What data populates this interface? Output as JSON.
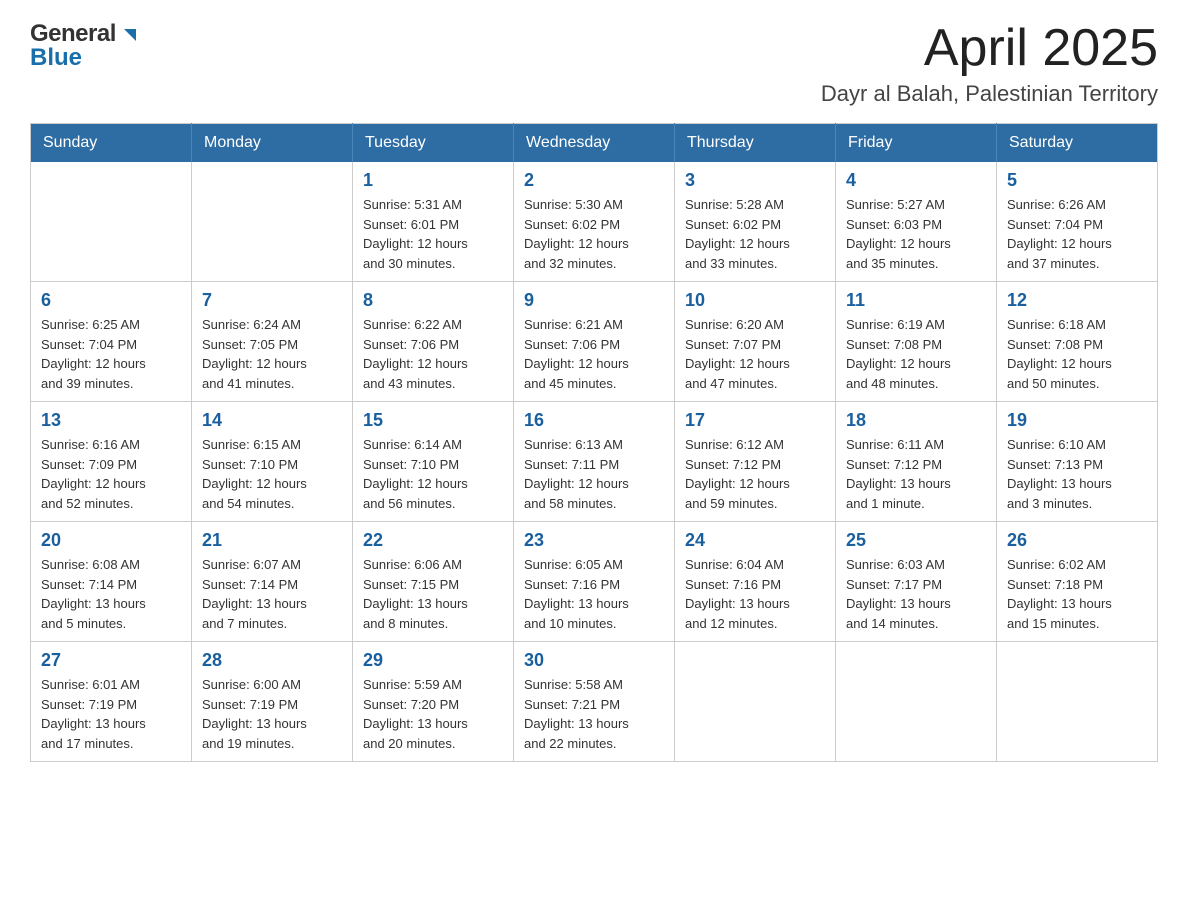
{
  "header": {
    "title": "April 2025",
    "subtitle": "Dayr al Balah, Palestinian Territory",
    "logo_general": "General",
    "logo_blue": "Blue"
  },
  "calendar": {
    "days_of_week": [
      "Sunday",
      "Monday",
      "Tuesday",
      "Wednesday",
      "Thursday",
      "Friday",
      "Saturday"
    ],
    "weeks": [
      [
        {
          "day": "",
          "info": ""
        },
        {
          "day": "",
          "info": ""
        },
        {
          "day": "1",
          "info": "Sunrise: 5:31 AM\nSunset: 6:01 PM\nDaylight: 12 hours\nand 30 minutes."
        },
        {
          "day": "2",
          "info": "Sunrise: 5:30 AM\nSunset: 6:02 PM\nDaylight: 12 hours\nand 32 minutes."
        },
        {
          "day": "3",
          "info": "Sunrise: 5:28 AM\nSunset: 6:02 PM\nDaylight: 12 hours\nand 33 minutes."
        },
        {
          "day": "4",
          "info": "Sunrise: 5:27 AM\nSunset: 6:03 PM\nDaylight: 12 hours\nand 35 minutes."
        },
        {
          "day": "5",
          "info": "Sunrise: 6:26 AM\nSunset: 7:04 PM\nDaylight: 12 hours\nand 37 minutes."
        }
      ],
      [
        {
          "day": "6",
          "info": "Sunrise: 6:25 AM\nSunset: 7:04 PM\nDaylight: 12 hours\nand 39 minutes."
        },
        {
          "day": "7",
          "info": "Sunrise: 6:24 AM\nSunset: 7:05 PM\nDaylight: 12 hours\nand 41 minutes."
        },
        {
          "day": "8",
          "info": "Sunrise: 6:22 AM\nSunset: 7:06 PM\nDaylight: 12 hours\nand 43 minutes."
        },
        {
          "day": "9",
          "info": "Sunrise: 6:21 AM\nSunset: 7:06 PM\nDaylight: 12 hours\nand 45 minutes."
        },
        {
          "day": "10",
          "info": "Sunrise: 6:20 AM\nSunset: 7:07 PM\nDaylight: 12 hours\nand 47 minutes."
        },
        {
          "day": "11",
          "info": "Sunrise: 6:19 AM\nSunset: 7:08 PM\nDaylight: 12 hours\nand 48 minutes."
        },
        {
          "day": "12",
          "info": "Sunrise: 6:18 AM\nSunset: 7:08 PM\nDaylight: 12 hours\nand 50 minutes."
        }
      ],
      [
        {
          "day": "13",
          "info": "Sunrise: 6:16 AM\nSunset: 7:09 PM\nDaylight: 12 hours\nand 52 minutes."
        },
        {
          "day": "14",
          "info": "Sunrise: 6:15 AM\nSunset: 7:10 PM\nDaylight: 12 hours\nand 54 minutes."
        },
        {
          "day": "15",
          "info": "Sunrise: 6:14 AM\nSunset: 7:10 PM\nDaylight: 12 hours\nand 56 minutes."
        },
        {
          "day": "16",
          "info": "Sunrise: 6:13 AM\nSunset: 7:11 PM\nDaylight: 12 hours\nand 58 minutes."
        },
        {
          "day": "17",
          "info": "Sunrise: 6:12 AM\nSunset: 7:12 PM\nDaylight: 12 hours\nand 59 minutes."
        },
        {
          "day": "18",
          "info": "Sunrise: 6:11 AM\nSunset: 7:12 PM\nDaylight: 13 hours\nand 1 minute."
        },
        {
          "day": "19",
          "info": "Sunrise: 6:10 AM\nSunset: 7:13 PM\nDaylight: 13 hours\nand 3 minutes."
        }
      ],
      [
        {
          "day": "20",
          "info": "Sunrise: 6:08 AM\nSunset: 7:14 PM\nDaylight: 13 hours\nand 5 minutes."
        },
        {
          "day": "21",
          "info": "Sunrise: 6:07 AM\nSunset: 7:14 PM\nDaylight: 13 hours\nand 7 minutes."
        },
        {
          "day": "22",
          "info": "Sunrise: 6:06 AM\nSunset: 7:15 PM\nDaylight: 13 hours\nand 8 minutes."
        },
        {
          "day": "23",
          "info": "Sunrise: 6:05 AM\nSunset: 7:16 PM\nDaylight: 13 hours\nand 10 minutes."
        },
        {
          "day": "24",
          "info": "Sunrise: 6:04 AM\nSunset: 7:16 PM\nDaylight: 13 hours\nand 12 minutes."
        },
        {
          "day": "25",
          "info": "Sunrise: 6:03 AM\nSunset: 7:17 PM\nDaylight: 13 hours\nand 14 minutes."
        },
        {
          "day": "26",
          "info": "Sunrise: 6:02 AM\nSunset: 7:18 PM\nDaylight: 13 hours\nand 15 minutes."
        }
      ],
      [
        {
          "day": "27",
          "info": "Sunrise: 6:01 AM\nSunset: 7:19 PM\nDaylight: 13 hours\nand 17 minutes."
        },
        {
          "day": "28",
          "info": "Sunrise: 6:00 AM\nSunset: 7:19 PM\nDaylight: 13 hours\nand 19 minutes."
        },
        {
          "day": "29",
          "info": "Sunrise: 5:59 AM\nSunset: 7:20 PM\nDaylight: 13 hours\nand 20 minutes."
        },
        {
          "day": "30",
          "info": "Sunrise: 5:58 AM\nSunset: 7:21 PM\nDaylight: 13 hours\nand 22 minutes."
        },
        {
          "day": "",
          "info": ""
        },
        {
          "day": "",
          "info": ""
        },
        {
          "day": "",
          "info": ""
        }
      ]
    ]
  }
}
